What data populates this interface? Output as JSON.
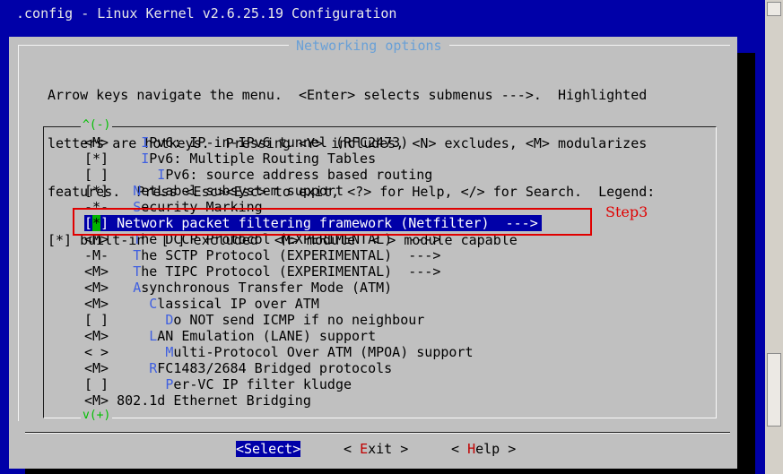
{
  "window": {
    "title": ".config - Linux Kernel v2.6.25.19 Configuration"
  },
  "dialog": {
    "title": "Networking options",
    "help_lines": [
      "Arrow keys navigate the menu.  <Enter> selects submenus --->.  Highlighted",
      "letters are hotkeys.  Pressing <Y> includes, <N> excludes, <M> modularizes",
      "features.  Press <Esc><Esc> to exit, <?> for Help, </> for Search.  Legend:",
      "[*] built-in  [ ] excluded  <M> module  < > module capable"
    ],
    "scroll_up": "^(-)",
    "scroll_down": "v(+)"
  },
  "menu": {
    "items": [
      {
        "mark": "<M>",
        "indent": "    ",
        "hot": "I",
        "rest": "Pv6: IP-in-IPv6 tunnel (RFC2473)",
        "selected": false
      },
      {
        "mark": "[*]",
        "indent": "    ",
        "hot": "I",
        "rest": "Pv6: Multiple Routing Tables",
        "selected": false
      },
      {
        "mark": "[ ]",
        "indent": "      ",
        "hot": "I",
        "rest": "Pv6: source address based routing",
        "selected": false
      },
      {
        "mark": "[*]",
        "indent": "   ",
        "hot": "N",
        "rest": "etLabel subsystem support",
        "selected": false
      },
      {
        "mark": "-*-",
        "indent": "   ",
        "hot": "S",
        "rest": "ecurity Marking",
        "selected": false
      },
      {
        "mark": "[*]",
        "indent": " ",
        "hot": "N",
        "rest": "etwork packet filtering framework (Netfilter)  --->",
        "selected": true
      },
      {
        "mark": "<M>",
        "indent": "   ",
        "hot": "T",
        "rest": "he DCCP Protocol (EXPERIMENTAL)  --->",
        "selected": false
      },
      {
        "mark": "-M-",
        "indent": "   ",
        "hot": "T",
        "rest": "he SCTP Protocol (EXPERIMENTAL)  --->",
        "selected": false
      },
      {
        "mark": "<M>",
        "indent": "   ",
        "hot": "T",
        "rest": "he TIPC Protocol (EXPERIMENTAL)  --->",
        "selected": false
      },
      {
        "mark": "<M>",
        "indent": "   ",
        "hot": "A",
        "rest": "synchronous Transfer Mode (ATM)",
        "selected": false
      },
      {
        "mark": "<M>",
        "indent": "     ",
        "hot": "C",
        "rest": "lassical IP over ATM",
        "selected": false
      },
      {
        "mark": "[ ]",
        "indent": "       ",
        "hot": "D",
        "rest": "o NOT send ICMP if no neighbour",
        "selected": false
      },
      {
        "mark": "<M>",
        "indent": "     ",
        "hot": "L",
        "rest": "AN Emulation (LANE) support",
        "selected": false
      },
      {
        "mark": "< >",
        "indent": "       ",
        "hot": "M",
        "rest": "ulti-Protocol Over ATM (MPOA) support",
        "selected": false
      },
      {
        "mark": "<M>",
        "indent": "     ",
        "hot": "R",
        "rest": "FC1483/2684 Bridged protocols",
        "selected": false
      },
      {
        "mark": "[ ]",
        "indent": "       ",
        "hot": "P",
        "rest": "er-VC IP filter kludge",
        "selected": false
      },
      {
        "mark": "<M>",
        "indent": " ",
        "hot": "",
        "rest": "802.1d Ethernet Bridging",
        "selected": false
      }
    ]
  },
  "buttons": {
    "select": "<Select>",
    "exit_pre": "< ",
    "exit_hot": "E",
    "exit_rest": "xit >",
    "help_pre": "< ",
    "help_hot": "H",
    "help_rest": "elp >"
  },
  "annotation": {
    "label": "Step3"
  },
  "colors": {
    "background": "#0000a8",
    "dialog": "#c0c0c0",
    "highlight": "#0000a8",
    "annotation": "#e00000"
  }
}
